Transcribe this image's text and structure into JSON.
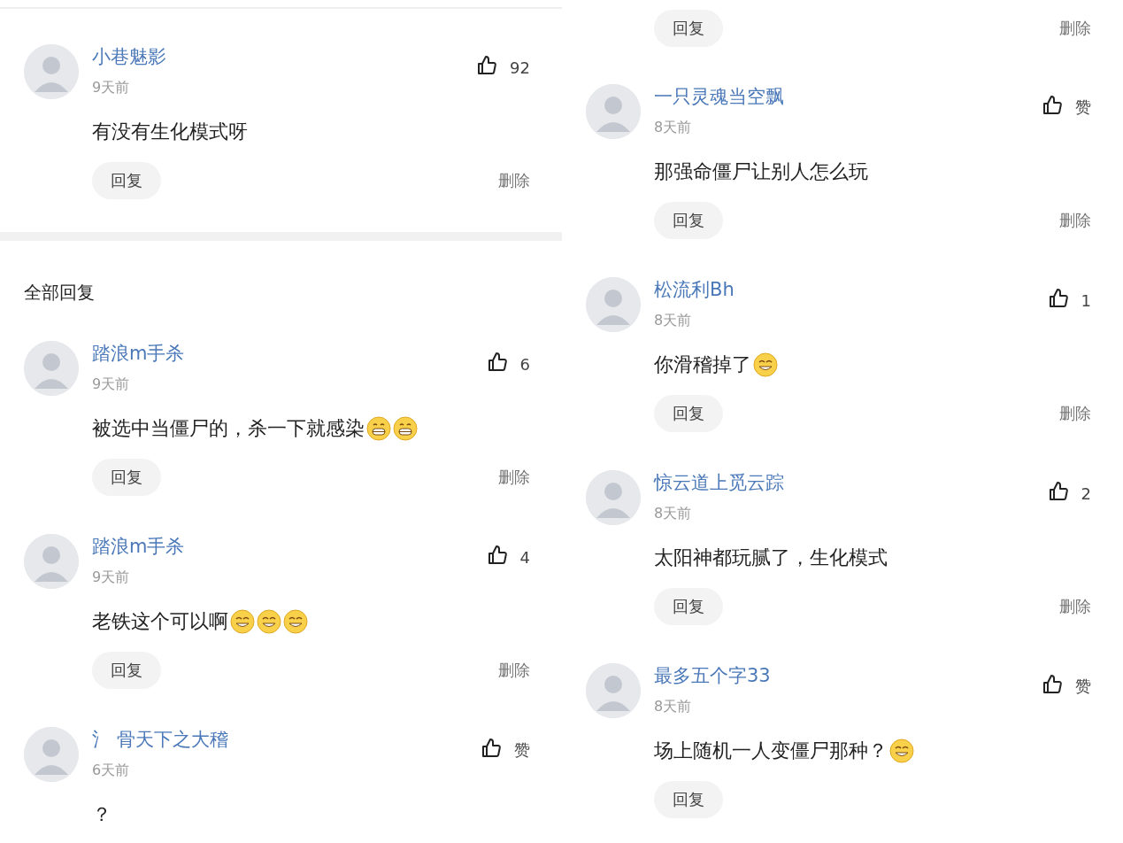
{
  "left_column": {
    "top_comment": {
      "name": "小巷魅影",
      "time": "9天前",
      "text": "有没有生化模式呀",
      "likes": "92",
      "reply": "回复",
      "delete": "删除"
    },
    "section_title": "全部回复",
    "comments": [
      {
        "name": "踏浪m手杀",
        "time": "9天前",
        "text": "被选中当僵尸的，杀一下就感染",
        "emojis": [
          {
            "kind": "grin"
          },
          {
            "kind": "grin"
          }
        ],
        "likes": "6",
        "reply": "回复",
        "delete": "删除"
      },
      {
        "name": "踏浪m手杀",
        "time": "9天前",
        "text": "老铁这个可以啊",
        "emojis": [
          {
            "kind": "smile"
          },
          {
            "kind": "smile"
          },
          {
            "kind": "smile"
          }
        ],
        "likes": "4",
        "reply": "回复",
        "delete": "删除"
      },
      {
        "name": "氵 骨天下之大稽",
        "time": "6天前",
        "text": "？",
        "likes": "赞"
      }
    ]
  },
  "right_column": {
    "partial_actions": {
      "reply": "回复",
      "delete": "删除"
    },
    "comments": [
      {
        "name": "一只灵魂当空飘",
        "time": "8天前",
        "text": "那强命僵尸让别人怎么玩",
        "likes": "赞",
        "reply": "回复",
        "delete": "删除"
      },
      {
        "name": "松流利Bh",
        "time": "8天前",
        "text": "你滑稽掉了",
        "emojis": [
          {
            "kind": "smile"
          }
        ],
        "likes": "1",
        "reply": "回复",
        "delete": "删除"
      },
      {
        "name": "惊云道上觅云踪",
        "time": "8天前",
        "text": "太阳神都玩腻了，生化模式",
        "likes": "2",
        "reply": "回复",
        "delete": "删除"
      },
      {
        "name": "最多五个字33",
        "time": "8天前",
        "text": "场上随机一人变僵尸那种？",
        "emojis": [
          {
            "kind": "smile"
          }
        ],
        "likes": "赞",
        "reply": "回复"
      }
    ]
  }
}
